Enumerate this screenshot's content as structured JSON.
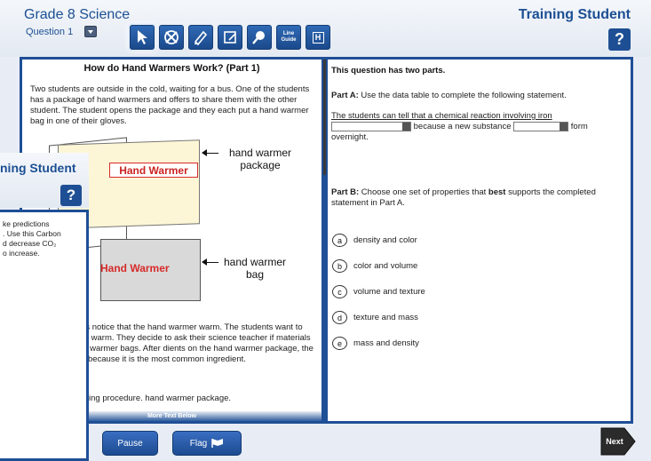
{
  "header": {
    "title": "Grade 8 Science",
    "student": "Training Student",
    "question_label": "Question 1",
    "help": "?"
  },
  "toolbar": {
    "tools": [
      {
        "name": "pointer-icon"
      },
      {
        "name": "eliminator-icon"
      },
      {
        "name": "highlighter-icon"
      },
      {
        "name": "notepad-icon"
      },
      {
        "name": "magnifier-icon"
      },
      {
        "name": "line-guide-icon",
        "label": "Line Guide"
      },
      {
        "name": "help-guide-icon",
        "label": "H"
      }
    ]
  },
  "passage": {
    "title": "How do Hand Warmers Work? (Part 1)",
    "p1": "Two students are outside in the cold, waiting for a bus. One of the students has a package of hand warmers and offers to share them with the other student. The student opens the package and they each put a hand warmer bag in one of their gloves.",
    "package_label": "Hand Warmer",
    "package_callout": "hand warmer package",
    "bag_label": "Hand Warmer",
    "bag_callout": "hand warmer bag",
    "p2": "es, the students notice that the hand warmer warm. The students want to know how hand warm. They decide to ask their science teacher if materials inside the hand warmer bags. After dients on the hand warmer package, the students n iron because it is the most common ingredient.",
    "p3": "igned the following procedure. hand warmer package.",
    "more_text": "More Text Below"
  },
  "question": {
    "intro": "This question has two parts.",
    "partA_label": "Part A:",
    "partA_text": " Use the data table to complete the following statement.",
    "stmt_line1": "The students can tell that a chemical reaction involving iron",
    "stmt_mid": " because a new substance ",
    "stmt_end": " form",
    "stmt_line3": "overnight.",
    "partB_label": "Part B:",
    "partB_pre": " Choose one set of properties that ",
    "partB_bold": "best",
    "partB_post": " supports the completed statement in Part A.",
    "choices": [
      {
        "letter": "a",
        "text": "density and color"
      },
      {
        "letter": "b",
        "text": "color and volume"
      },
      {
        "letter": "c",
        "text": "volume and texture"
      },
      {
        "letter": "d",
        "text": "texture and mass"
      },
      {
        "letter": "e",
        "text": "mass and density"
      }
    ]
  },
  "footer": {
    "pause": "Pause",
    "flag": "Flag",
    "next": "Next"
  },
  "overlay": {
    "title": "ning Student",
    "help": "?",
    "text_lines": [
      "ke predictions",
      ". Use this Carbon",
      "d decrease CO₂",
      "o increase."
    ]
  },
  "colors": {
    "brand_blue": "#1f4f96",
    "title_blue": "#1c4f93",
    "warmer_red": "#d62a2a"
  }
}
